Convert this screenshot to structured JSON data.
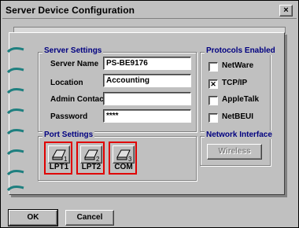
{
  "window": {
    "title": "Server Device Configuration",
    "close_glyph": "×"
  },
  "server_settings": {
    "title": "Server Settings",
    "fields": [
      {
        "label": "Server Name",
        "value": "PS-BE9176"
      },
      {
        "label": "Location",
        "value": "Accounting"
      },
      {
        "label": "Admin Contact",
        "value": ""
      },
      {
        "label": "Password",
        "value": "****"
      }
    ]
  },
  "protocols": {
    "title": "Protocols Enabled",
    "items": [
      {
        "label": "NetWare",
        "checked": false
      },
      {
        "label": "TCP/IP",
        "checked": true
      },
      {
        "label": "AppleTalk",
        "checked": false
      },
      {
        "label": "NetBEUI",
        "checked": false
      }
    ],
    "check_glyph": "✕"
  },
  "port_settings": {
    "title": "Port Settings",
    "ports": [
      {
        "label": "LPT1",
        "number": "1",
        "icon": "printer-port-icon"
      },
      {
        "label": "LPT2",
        "number": "2",
        "icon": "printer-port-icon"
      },
      {
        "label": "COM",
        "number": "3",
        "icon": "printer-port-icon"
      }
    ],
    "highlight_color": "#e00000"
  },
  "network_interface": {
    "title": "Network Interface",
    "button": "Wireless"
  },
  "actions": {
    "ok": "OK",
    "cancel": "Cancel"
  },
  "colors": {
    "group_title": "#000080",
    "ring": "#1e7f7f",
    "face": "#c0c0c0"
  }
}
